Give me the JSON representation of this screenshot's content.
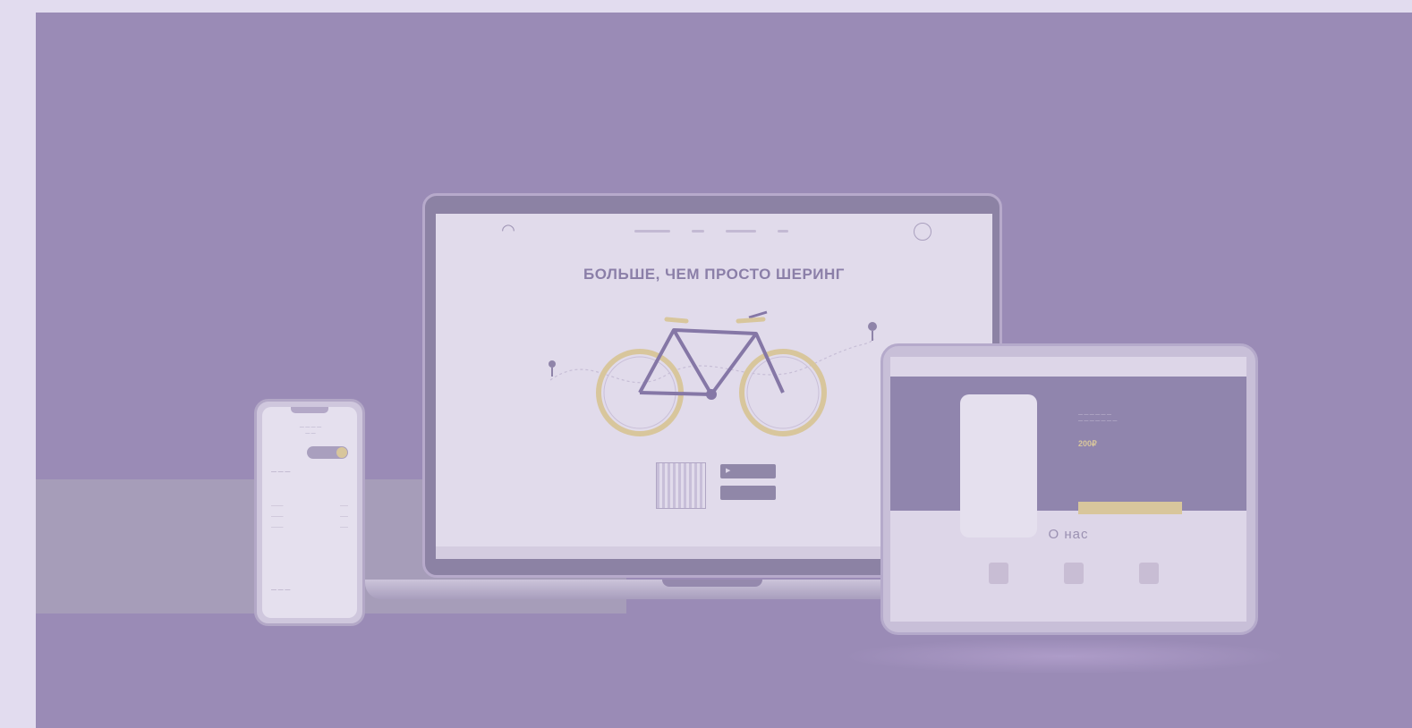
{
  "hero": {
    "title": "БОЛЬШЕ, ЧЕМ ПРОСТО ШЕРИНГ"
  },
  "tablet": {
    "price": "200₽",
    "about_title": "О нас"
  },
  "colors": {
    "background": "#9a8bb6",
    "accent": "#d8c69c",
    "screen": "#e1dbeb"
  }
}
